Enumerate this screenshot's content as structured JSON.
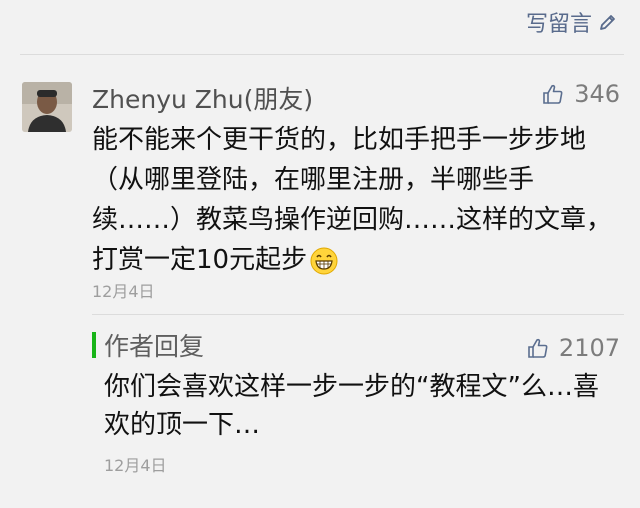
{
  "header": {
    "write_comment_label": "写留言",
    "write_icon": "pencil-icon"
  },
  "comment": {
    "user_name": "Zhenyu Zhu(朋友)",
    "avatar": "user-avatar",
    "like_icon": "thumbs-up-icon",
    "like_count": "346",
    "text": "能不能来个更干货的，比如手把手一步步地（从哪里登陆，在哪里注册，半哪些手续……）教菜鸟操作逆回购……这样的文章，打赏一定10元起步",
    "emoji": "grinning-face-icon",
    "date": "12月4日"
  },
  "reply": {
    "label": "作者回复",
    "like_icon": "thumbs-up-icon",
    "like_count": "2107",
    "text": "你们会喜欢这样一步一步的“教程文”么…喜欢的顶一下…",
    "date": "12月4日"
  },
  "colors": {
    "link": "#596b8c",
    "reply_bar": "#18b418",
    "background": "#f2f2f2"
  }
}
